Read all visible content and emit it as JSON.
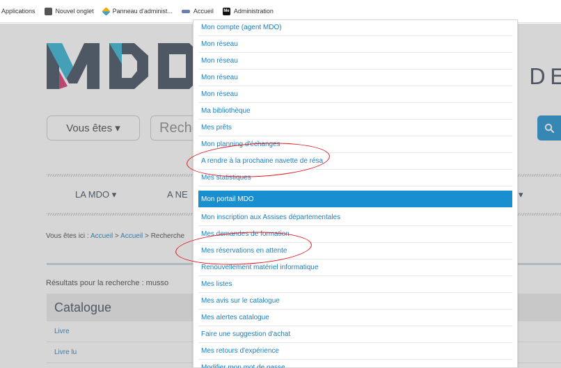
{
  "bookmarks": [
    {
      "label": "Applications",
      "icon": "apps-grid-icon"
    },
    {
      "label": "Nouvel onglet",
      "icon": "globe-icon"
    },
    {
      "label": "Panneau d'administ...",
      "icon": "admin-logo-icon"
    },
    {
      "label": "Accueil",
      "icon": "site-logo-icon"
    },
    {
      "label": "Administration",
      "icon": "me-logo-icon",
      "badge": "Me"
    }
  ],
  "header": {
    "de_text": "DE",
    "vous_etes": "Vous êtes ▾",
    "search_placeholder": "Reche"
  },
  "nav": {
    "la_mdo": "LA MDO ▾",
    "a_ne": "A NE",
    "caret": "▾"
  },
  "breadcrumb": {
    "prefix": "Vous êtes ici : ",
    "link1": "Accueil",
    "sep1": " > ",
    "link2": "Accueil",
    "rest": " > Recherche"
  },
  "results_text": "Résultats pour la recherche : musso",
  "catalogue": {
    "heading": "Catalogue",
    "rows": [
      "Livre",
      "Livre lu"
    ]
  },
  "menu": {
    "items": [
      "Mon compte (agent MDO)",
      "Mon réseau",
      "Mon réseau",
      "Mon réseau",
      "Mon réseau",
      "Ma bibliothèque",
      "Mes prêts",
      "Mon planning d'échanges",
      "A rendre à la prochaine navette de résa",
      "Mes statistiques",
      "Mon portail MDO",
      "Mon inscription aux Assises départementales",
      "Mes demandes de formation",
      "Mes réservations en attente",
      "Renouvellement matériel informatique",
      "Mes listes",
      "Mes avis sur le catalogue",
      "Mes alertes catalogue",
      "Faire une suggestion d'achat",
      "Mes retours d'expérience",
      "Modifier mon mot de passe"
    ],
    "active_index": 10
  },
  "colors": {
    "accent": "#1a8fcf",
    "link": "#1a7fbf",
    "annotation": "#e3131b"
  }
}
